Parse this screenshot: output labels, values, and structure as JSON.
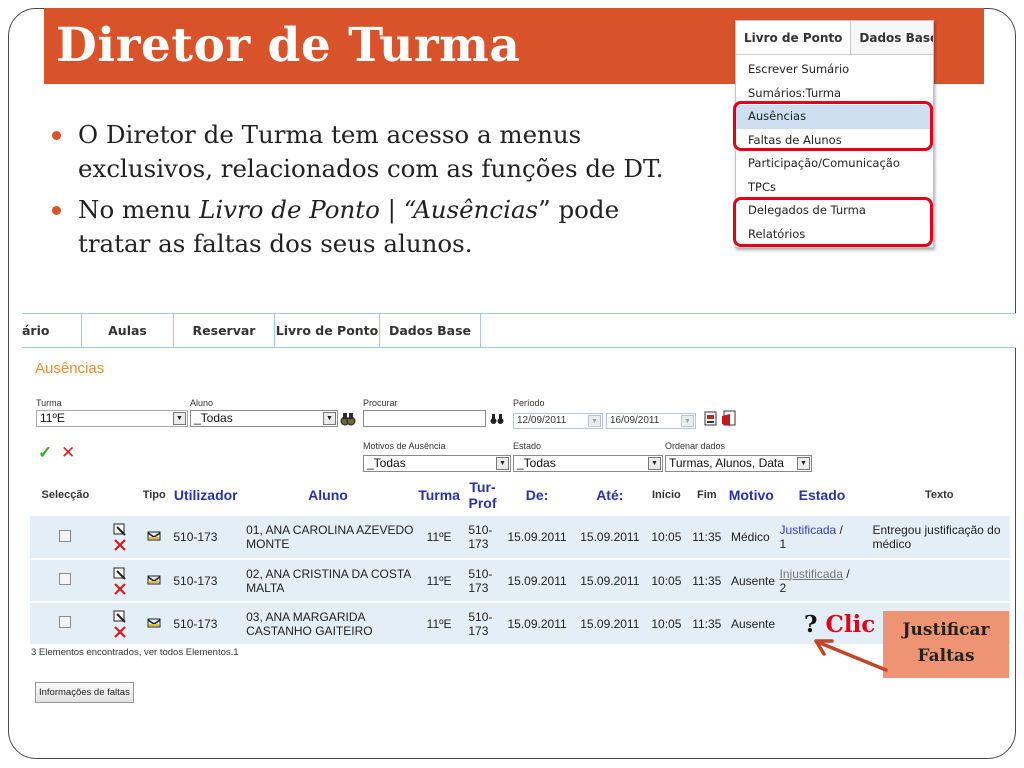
{
  "slide": {
    "title": "Diretor de Turma",
    "bullets": [
      {
        "text": "O Diretor de Turma tem acesso a menus exclusivos, relacionados com as funções de DT."
      },
      {
        "pre": "No menu ",
        "it1": "Livro de Ponto",
        "mid": " | ",
        "it2": "“Ausências",
        "post": "” pode tratar as faltas dos seus alunos."
      }
    ]
  },
  "menu": {
    "tabs": [
      "Livro de Ponto",
      "Dados Base"
    ],
    "items": [
      "Escrever Sumário",
      "Sumários:Turma",
      "Ausências",
      "Faltas de Alunos",
      "Participação/Comunicação",
      "TPCs",
      "Delegados de Turma",
      "Relatórios"
    ],
    "highlight_color": "#e2001a"
  },
  "nav": {
    "items": [
      "ário",
      "Aulas",
      "Reservar",
      "Livro de Ponto",
      "Dados Base"
    ]
  },
  "page": {
    "title": "Ausências",
    "title_color": "#e8902c"
  },
  "filters": {
    "turma_label": "Turma",
    "turma_value": "11ºE",
    "aluno_label": "Aluno",
    "aluno_value": "_Todas",
    "procurar_label": "Procurar",
    "procurar_value": "",
    "periodo_label": "Período",
    "periodo_from": "12/09/2011",
    "periodo_to": "16/09/2011",
    "motivos_label": "Motivos de Ausência",
    "motivos_value": "_Todas",
    "estado_label": "Estado",
    "estado_value": "_Todas",
    "ordenar_label": "Ordenar dados",
    "ordenar_value": "Turmas, Alunos, Data",
    "check_symbol": "✓",
    "cross_symbol": "✕"
  },
  "table": {
    "headers": [
      "Selecção",
      "Tipo",
      "Utilizador",
      "Aluno",
      "Turma",
      "Tur-Prof",
      "De:",
      "Até:",
      "Início",
      "Fim",
      "Motivo",
      "Estado",
      "Texto"
    ],
    "rows": [
      {
        "utilizador": "510-173",
        "aluno": "01, ANA CAROLINA AZEVEDO MONTE",
        "turma": "11ºE",
        "turprof": "510-173",
        "de": "15.09.2011",
        "ate": "15.09.2011",
        "inicio": "10:05",
        "fim": "11:35",
        "motivo": "Médico",
        "estado": "Justificada",
        "estado_num": "1",
        "texto": "Entregou justificação do médico"
      },
      {
        "utilizador": "510-173",
        "aluno": "02, ANA CRISTINA DA COSTA MALTA",
        "turma": "11ºE",
        "turprof": "510-173",
        "de": "15.09.2011",
        "ate": "15.09.2011",
        "inicio": "10:05",
        "fim": "11:35",
        "motivo": "Ausente",
        "estado": "Injustificada",
        "estado_num": "2",
        "texto": ""
      },
      {
        "utilizador": "510-173",
        "aluno": "03, ANA MARGARIDA CASTANHO GAITEIRO",
        "turma": "11ºE",
        "turprof": "510-173",
        "de": "15.09.2011",
        "ate": "15.09.2011",
        "inicio": "10:05",
        "fim": "11:35",
        "motivo": "Ausente",
        "estado": "",
        "estado_num": "",
        "texto": ""
      }
    ],
    "footer": "3 Elementos encontrados, ver todos Elementos.1",
    "info_button": "Informações de faltas"
  },
  "annotation": {
    "question": "?",
    "clic": "Clic",
    "callout_line1": "Justificar",
    "callout_line2": "Faltas",
    "callout_color": "#ee9473",
    "arrow_color": "#c2452a"
  }
}
